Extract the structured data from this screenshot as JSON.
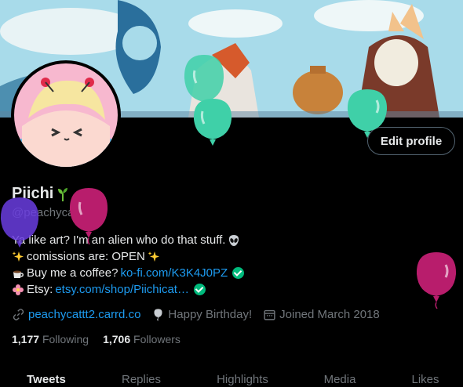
{
  "profile": {
    "display_name": "Piichi",
    "handle": "@peachycattt2",
    "edit_label": "Edit profile"
  },
  "bio": {
    "line1": "Ya like art? I'm an alien who do that stuff.",
    "line2": "comissions are: OPEN",
    "line3_text": "Buy me a coffee?",
    "line3_link": "ko-fi.com/K3K4J0PZ",
    "line4_text": "Etsy:",
    "line4_link": "etsy.com/shop/Piichicat…"
  },
  "meta": {
    "website": "peachycattt2.carrd.co",
    "birthday": "Happy Birthday!",
    "joined": "Joined March 2018"
  },
  "stats": {
    "following_count": "1,177",
    "following_label": "Following",
    "followers_count": "1,706",
    "followers_label": "Followers"
  },
  "tabs": [
    "Tweets",
    "Replies",
    "Highlights",
    "Media",
    "Likes"
  ],
  "icons": {
    "link": "link-icon",
    "birthday": "balloon-icon",
    "joined": "calendar-icon"
  },
  "colors": {
    "accent": "#1d9bf0",
    "verified": "#00ba7c",
    "balloon_green": "#3fd0a8",
    "balloon_magenta": "#b81d6c",
    "balloon_purple": "#6a3de0"
  }
}
